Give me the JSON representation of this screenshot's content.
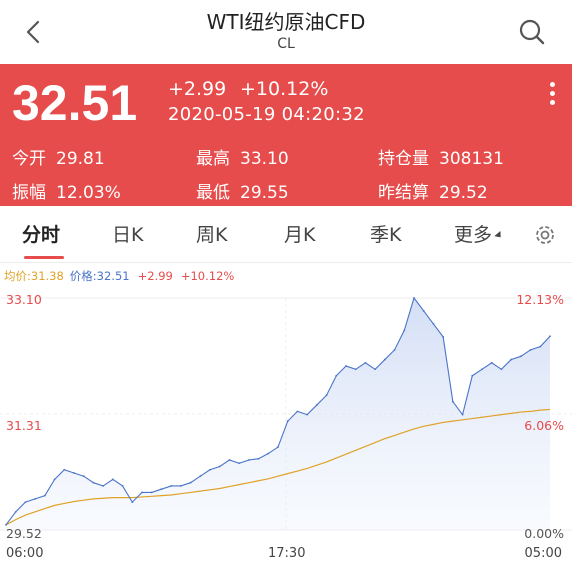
{
  "header": {
    "title": "WTI纽约原油CFD",
    "subtitle": "CL"
  },
  "quote": {
    "price": "32.51",
    "change": "+2.99",
    "change_pct": "+10.12%",
    "timestamp": "2020-05-19 04:20:32",
    "stats": {
      "open_label": "今开",
      "open_value": "29.81",
      "high_label": "最高",
      "high_value": "33.10",
      "oi_label": "持仓量",
      "oi_value": "308131",
      "amp_label": "振幅",
      "amp_value": "12.03%",
      "low_label": "最低",
      "low_value": "29.55",
      "prev_label": "昨结算",
      "prev_value": "29.52"
    }
  },
  "tabs": [
    "分时",
    "日K",
    "周K",
    "月K",
    "季K",
    "更多"
  ],
  "active_tab": "分时",
  "legend": {
    "avg": "均价:31.38",
    "price": "价格:32.51",
    "change": "+2.99",
    "change_pct": "+10.12%"
  },
  "axes": {
    "y_top_left": "33.10",
    "y_mid_left": "31.31",
    "y_bottom_left": "29.52",
    "y_top_right": "12.13%",
    "y_mid_right": "6.06%",
    "y_bottom_right": "0.00%",
    "x_start": "06:00",
    "x_mid": "17:30",
    "x_end": "05:00"
  },
  "colors": {
    "accent_red": "#e64c4c",
    "price_line": "#4a74c9",
    "avg_line": "#e0a227"
  },
  "icons": {
    "back": "chevron-left-icon",
    "search": "search-icon",
    "more": "more-vertical-icon",
    "settings": "settings-icon"
  },
  "chart_data": {
    "type": "line",
    "ylim": [
      29.52,
      33.1
    ],
    "y_pct_lim": [
      0.0,
      12.13
    ],
    "x_ticks": [
      "06:00",
      "17:30",
      "05:00"
    ],
    "series": [
      {
        "name": "价格",
        "values": [
          29.6,
          29.8,
          29.95,
          30.0,
          30.05,
          30.3,
          30.45,
          30.4,
          30.35,
          30.25,
          30.2,
          30.3,
          30.2,
          29.95,
          30.1,
          30.1,
          30.15,
          30.2,
          30.2,
          30.25,
          30.35,
          30.45,
          30.5,
          30.6,
          30.55,
          30.6,
          30.62,
          30.7,
          30.8,
          31.2,
          31.35,
          31.3,
          31.45,
          31.6,
          31.9,
          32.05,
          32.0,
          32.1,
          32.0,
          32.15,
          32.3,
          32.6,
          33.1,
          32.9,
          32.7,
          32.5,
          31.5,
          31.3,
          31.9,
          32.0,
          32.1,
          32.0,
          32.15,
          32.2,
          32.3,
          32.35,
          32.51
        ]
      },
      {
        "name": "均价",
        "values": [
          29.6,
          29.68,
          29.75,
          29.8,
          29.85,
          29.9,
          29.93,
          29.96,
          29.98,
          30.0,
          30.01,
          30.02,
          30.02,
          30.02,
          30.03,
          30.04,
          30.05,
          30.06,
          30.08,
          30.1,
          30.12,
          30.14,
          30.16,
          30.19,
          30.22,
          30.25,
          30.28,
          30.31,
          30.35,
          30.39,
          30.43,
          30.47,
          30.52,
          30.57,
          30.63,
          30.69,
          30.75,
          30.81,
          30.87,
          30.93,
          30.98,
          31.03,
          31.08,
          31.12,
          31.15,
          31.18,
          31.2,
          31.22,
          31.24,
          31.26,
          31.28,
          31.3,
          31.32,
          31.34,
          31.35,
          31.37,
          31.38
        ]
      }
    ]
  }
}
